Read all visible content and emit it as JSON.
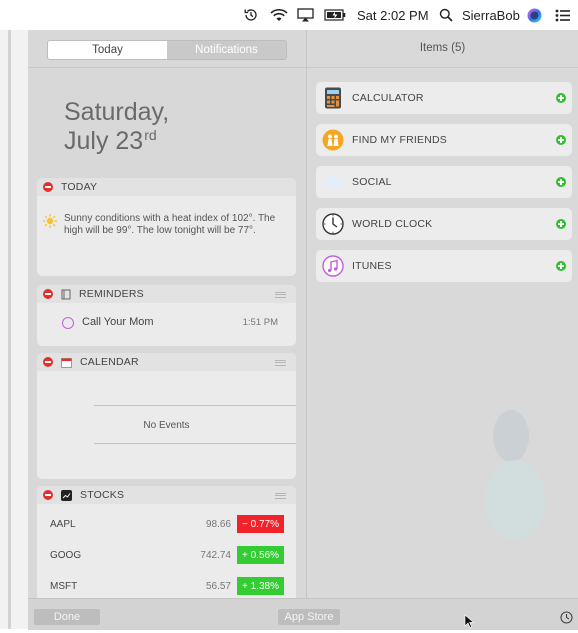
{
  "menubar": {
    "clock": "Sat 2:02 PM",
    "user": "SierraBob",
    "icons": [
      "time-machine-icon",
      "wifi-icon",
      "airplay-icon",
      "battery-icon",
      "spotlight-search-icon",
      "siri-icon",
      "notification-center-icon"
    ]
  },
  "tabs": {
    "today": "Today",
    "notifications": "Notifications"
  },
  "date": {
    "line1": "Saturday,",
    "line2": "July 23",
    "suffix": "rd"
  },
  "widgets": {
    "today": {
      "title": "TODAY",
      "forecast": "Sunny conditions with a heat index of 102°. The high will be 99°. The low tonight will be 77°."
    },
    "reminders": {
      "title": "REMINDERS",
      "items": [
        {
          "text": "Call Your Mom",
          "time": "1:51 PM"
        }
      ]
    },
    "calendar": {
      "title": "CALENDAR",
      "empty_text": "No Events"
    },
    "stocks": {
      "title": "STOCKS",
      "rows": [
        {
          "symbol": "AAPL",
          "price": "98.66",
          "change": "− 0.77%",
          "direction": "down"
        },
        {
          "symbol": "GOOG",
          "price": "742.74",
          "change": "+ 0.56%",
          "direction": "up"
        },
        {
          "symbol": "MSFT",
          "price": "56.57",
          "change": "+ 1.38%",
          "direction": "up"
        }
      ]
    }
  },
  "items_panel": {
    "header": "Items (5)",
    "items": [
      {
        "label": "CALCULATOR",
        "icon": "calculator-icon"
      },
      {
        "label": "FIND MY FRIENDS",
        "icon": "find-my-friends-icon"
      },
      {
        "label": "SOCIAL",
        "icon": "social-icon"
      },
      {
        "label": "WORLD CLOCK",
        "icon": "world-clock-icon"
      },
      {
        "label": "ITUNES",
        "icon": "itunes-icon"
      }
    ]
  },
  "bottom": {
    "done": "Done",
    "app_store": "App Store"
  },
  "colors": {
    "remove": "#e0322d",
    "add": "#2ec02a",
    "stock_down": "#f0232a",
    "stock_up": "#33cc33"
  }
}
